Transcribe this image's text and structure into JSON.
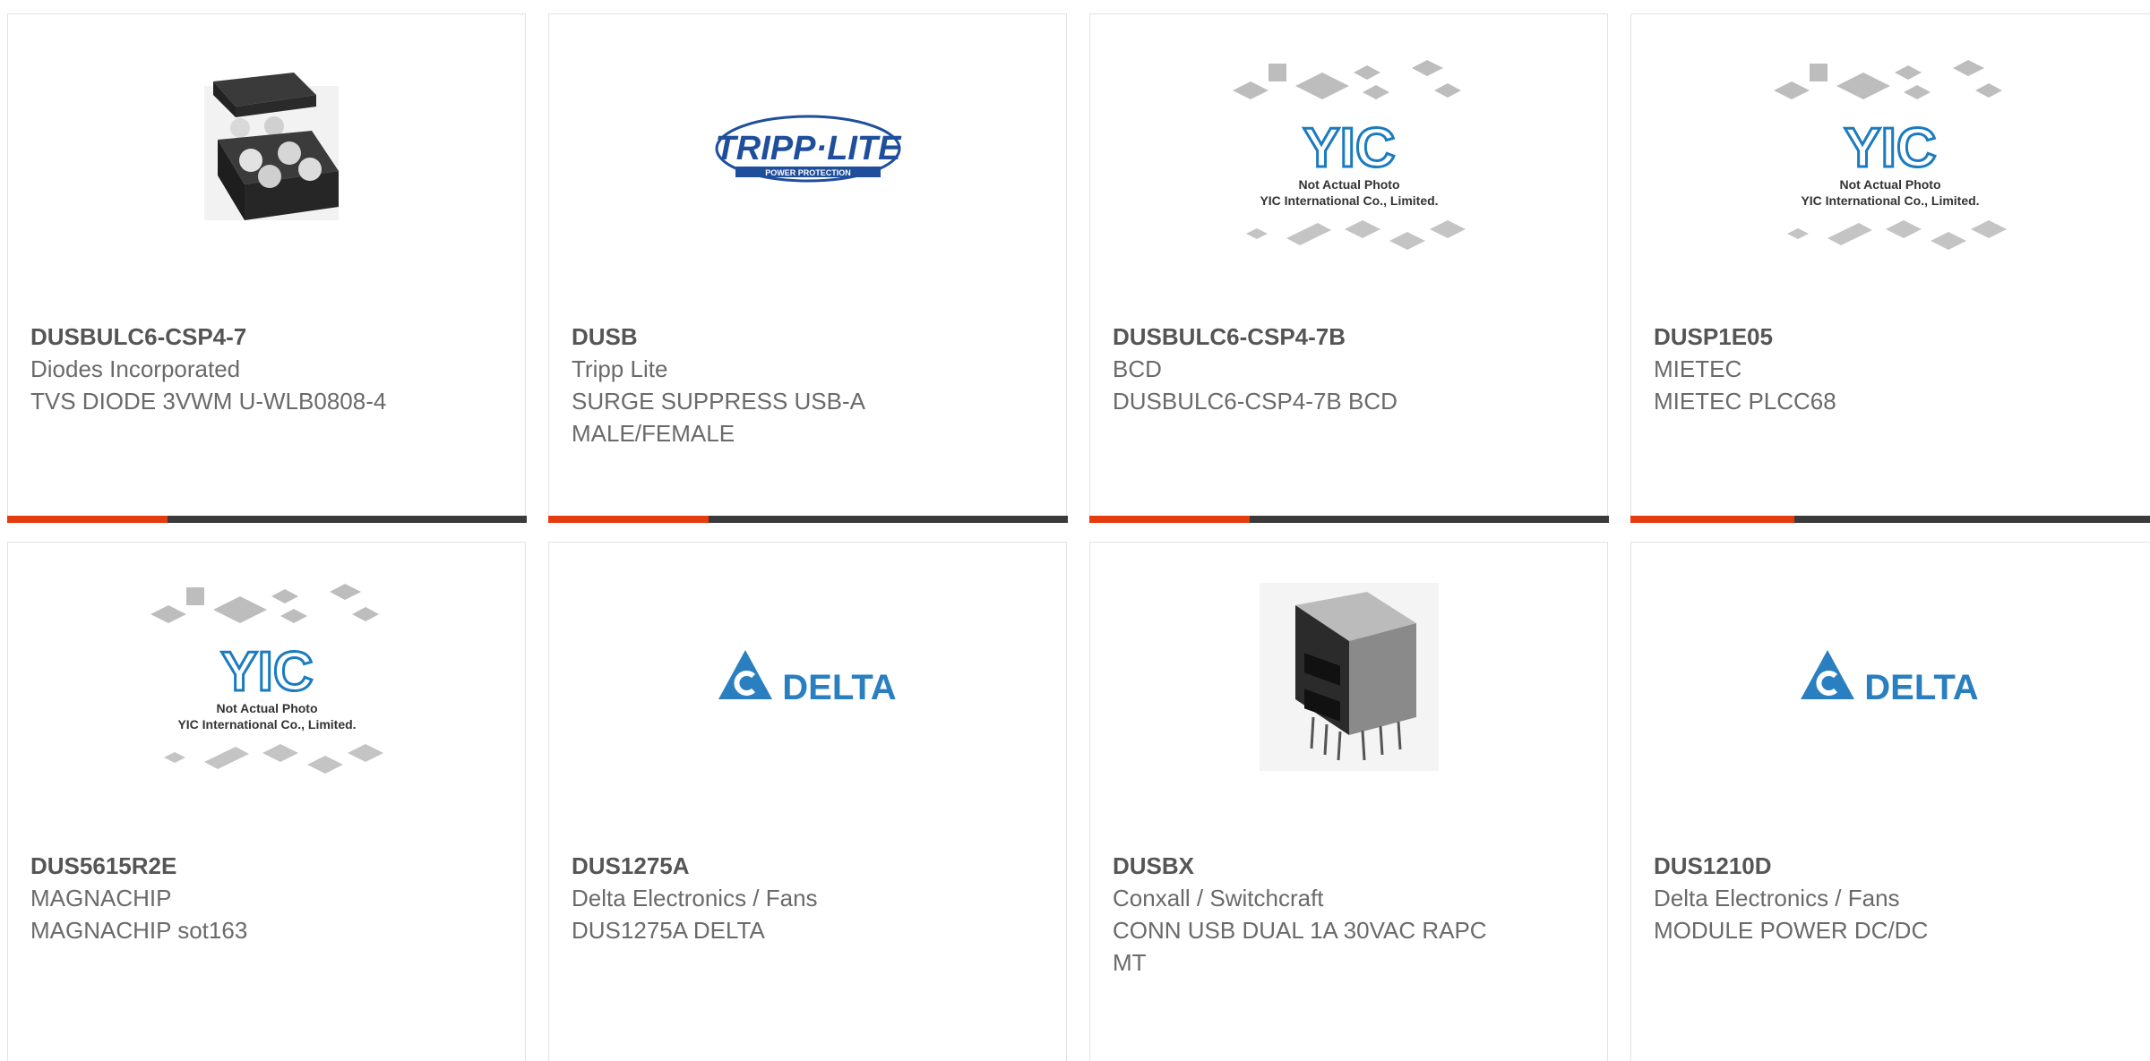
{
  "products": [
    {
      "part_number": "DUSBULC6-CSP4-7",
      "manufacturer": "Diodes Incorporated",
      "description": "TVS DIODE 3VWM U-WLB0808-4",
      "image": "chip-package-photo"
    },
    {
      "part_number": "DUSB",
      "manufacturer": "Tripp Lite",
      "description": "SURGE SUPPRESS USB-A MALE/FEMALE",
      "image": "tripp-lite-logo",
      "logo_text": "TRIPP·LITE",
      "logo_subtext": "POWER PROTECTION"
    },
    {
      "part_number": "DUSBULC6-CSP4-7B",
      "manufacturer": "BCD",
      "description": "DUSBULC6-CSP4-7B BCD",
      "image": "yic-placeholder",
      "logo_text": "YIC",
      "note_line1": "Not Actual Photo",
      "note_line2": "YIC International Co., Limited."
    },
    {
      "part_number": "DUSP1E05",
      "manufacturer": "MIETEC",
      "description": "MIETEC PLCC68",
      "image": "yic-placeholder",
      "logo_text": "YIC",
      "note_line1": "Not Actual Photo",
      "note_line2": "YIC International Co., Limited."
    },
    {
      "part_number": "DUS5615R2E",
      "manufacturer": "MAGNACHIP",
      "description": "MAGNACHIP sot163",
      "image": "yic-placeholder",
      "logo_text": "YIC",
      "note_line1": "Not Actual Photo",
      "note_line2": "YIC International Co., Limited."
    },
    {
      "part_number": "DUS1275A",
      "manufacturer": "Delta Electronics / Fans",
      "description": "DUS1275A DELTA",
      "image": "delta-logo",
      "logo_text": "DELTA"
    },
    {
      "part_number": "DUSBX",
      "manufacturer": "Conxall / Switchcraft",
      "description": "CONN USB DUAL 1A 30VAC RAPC MT",
      "image": "usb-connector-photo"
    },
    {
      "part_number": "DUS1210D",
      "manufacturer": "Delta Electronics / Fans",
      "description": "MODULE POWER DC/DC",
      "image": "delta-logo",
      "logo_text": "DELTA"
    }
  ],
  "colors": {
    "accent": "#e63b0f",
    "bar": "#3a3a3a",
    "yic_blue": "#1a7bc0",
    "delta_blue": "#2a7fc1",
    "tripp_blue": "#1f4e9c"
  }
}
